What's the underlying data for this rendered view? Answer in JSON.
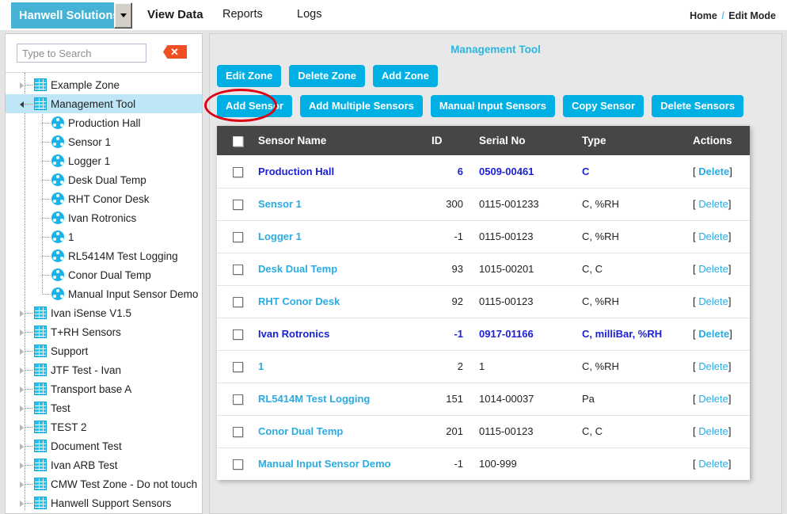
{
  "topnav": {
    "brand": "Hanwell Solutions",
    "dropdown_icon": "chevron-down-icon",
    "links": [
      {
        "label": "View Data"
      },
      {
        "label": "Reports"
      },
      {
        "label": "Logs"
      }
    ],
    "breadcrumb": {
      "home": "Home",
      "separator": "/",
      "current": "Edit Mode"
    }
  },
  "sidebar": {
    "search": {
      "placeholder": "Type to Search",
      "value": ""
    },
    "clear_icon": "close-icon",
    "tree": [
      {
        "label": "Example Zone",
        "type": "zone",
        "state": "collapsed",
        "selected": false
      },
      {
        "label": "Management Tool",
        "type": "zone",
        "state": "expanded",
        "selected": true
      },
      {
        "label": "Production Hall",
        "type": "sensor",
        "state": "leaf",
        "selected": false
      },
      {
        "label": "Sensor 1",
        "type": "sensor",
        "state": "leaf",
        "selected": false
      },
      {
        "label": "Logger 1",
        "type": "sensor",
        "state": "leaf",
        "selected": false
      },
      {
        "label": "Desk Dual Temp",
        "type": "sensor",
        "state": "leaf",
        "selected": false
      },
      {
        "label": "RHT Conor Desk",
        "type": "sensor",
        "state": "leaf",
        "selected": false
      },
      {
        "label": "Ivan Rotronics",
        "type": "sensor",
        "state": "leaf",
        "selected": false
      },
      {
        "label": "1",
        "type": "sensor",
        "state": "leaf",
        "selected": false
      },
      {
        "label": "RL5414M Test Logging",
        "type": "sensor",
        "state": "leaf",
        "selected": false
      },
      {
        "label": "Conor Dual Temp",
        "type": "sensor",
        "state": "leaf",
        "selected": false
      },
      {
        "label": "Manual Input Sensor Demo",
        "type": "sensor",
        "state": "leaf",
        "selected": false
      },
      {
        "label": "Ivan iSense V1.5",
        "type": "zone",
        "state": "collapsed",
        "selected": false
      },
      {
        "label": "T+RH Sensors",
        "type": "zone",
        "state": "collapsed",
        "selected": false
      },
      {
        "label": "Support",
        "type": "zone",
        "state": "collapsed",
        "selected": false
      },
      {
        "label": "JTF Test - Ivan",
        "type": "zone",
        "state": "collapsed",
        "selected": false
      },
      {
        "label": "Transport base A",
        "type": "zone",
        "state": "collapsed",
        "selected": false
      },
      {
        "label": "Test",
        "type": "zone",
        "state": "collapsed",
        "selected": false
      },
      {
        "label": "TEST 2",
        "type": "zone",
        "state": "collapsed",
        "selected": false
      },
      {
        "label": "Document Test",
        "type": "zone",
        "state": "collapsed",
        "selected": false
      },
      {
        "label": "Ivan ARB Test",
        "type": "zone",
        "state": "collapsed",
        "selected": false
      },
      {
        "label": "CMW Test Zone - Do not touch",
        "type": "zone",
        "state": "collapsed",
        "selected": false
      },
      {
        "label": "Hanwell Support Sensors",
        "type": "zone",
        "state": "collapsed",
        "selected": false
      }
    ]
  },
  "content": {
    "title": "Management Tool",
    "zone_buttons": [
      {
        "label": "Edit Zone",
        "highlighted": true
      },
      {
        "label": "Delete Zone",
        "highlighted": false
      },
      {
        "label": "Add Zone",
        "highlighted": false
      }
    ],
    "sensor_buttons": [
      {
        "label": "Add Sensor"
      },
      {
        "label": "Add Multiple Sensors"
      },
      {
        "label": "Manual Input Sensors"
      },
      {
        "label": "Copy Sensor"
      },
      {
        "label": "Delete Sensors"
      }
    ],
    "table": {
      "columns": [
        "",
        "Sensor Name",
        "ID",
        "Serial No",
        "Type",
        "Actions"
      ],
      "action_label": "Delete",
      "rows": [
        {
          "name": "Production Hall",
          "id": "6",
          "serial": "0509-00461",
          "type": "C",
          "visited": true
        },
        {
          "name": "Sensor 1",
          "id": "300",
          "serial": "0115-001233",
          "type": "C, %RH",
          "visited": false
        },
        {
          "name": "Logger 1",
          "id": "-1",
          "serial": "0115-00123",
          "type": "C, %RH",
          "visited": false
        },
        {
          "name": "Desk Dual Temp",
          "id": "93",
          "serial": "1015-00201",
          "type": "C, C",
          "visited": false
        },
        {
          "name": "RHT Conor Desk",
          "id": "92",
          "serial": "0115-00123",
          "type": "C, %RH",
          "visited": false
        },
        {
          "name": "Ivan Rotronics",
          "id": "-1",
          "serial": "0917-01166",
          "type": "C, milliBar, %RH",
          "visited": true
        },
        {
          "name": "1",
          "id": "2",
          "serial": "1",
          "type": "C, %RH",
          "visited": false
        },
        {
          "name": "RL5414M Test Logging",
          "id": "151",
          "serial": "1014-00037",
          "type": "Pa",
          "visited": false
        },
        {
          "name": "Conor Dual Temp",
          "id": "201",
          "serial": "0115-00123",
          "type": "C, C",
          "visited": false
        },
        {
          "name": "Manual Input Sensor Demo",
          "id": "-1",
          "serial": "100-999",
          "type": "",
          "visited": false
        }
      ]
    }
  },
  "annotation": {
    "shape": "ellipse",
    "color": "#e00014",
    "target": "Edit Zone"
  },
  "colors": {
    "brand_blue": "#45b2d6",
    "button_blue": "#00b0e4",
    "link_blue": "#29ace3",
    "visited_blue": "#1c21d4",
    "table_header": "#464646",
    "annotation_red": "#e00014",
    "clear_orange": "#f04e23"
  }
}
